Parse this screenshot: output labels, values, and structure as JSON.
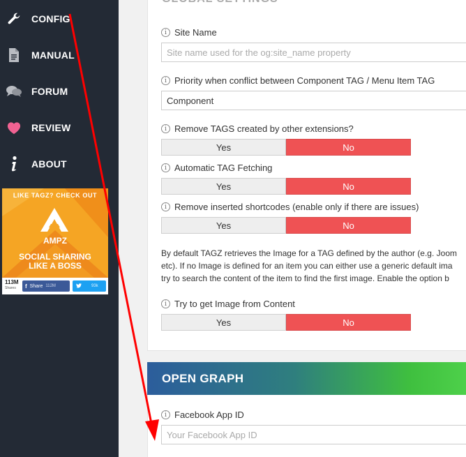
{
  "sidebar": {
    "items": [
      {
        "label": "CONFIG",
        "icon": "wrench-icon"
      },
      {
        "label": "MANUAL",
        "icon": "document-icon"
      },
      {
        "label": "FORUM",
        "icon": "chat-bubbles-icon"
      },
      {
        "label": "REVIEW",
        "icon": "heart-icon"
      },
      {
        "label": "ABOUT",
        "icon": "info-icon"
      }
    ],
    "ad": {
      "headline": "LIKE TAGZ? CHECK OUT",
      "brand": "AMPZ",
      "tagline_1": "SOCIAL SHARING",
      "tagline_2": "LIKE A BOSS",
      "shares_count": "113M",
      "shares_label": "Shares",
      "facebook_label": "Share",
      "facebook_count": "112M",
      "twitter_count": "93k"
    }
  },
  "global_settings": {
    "title": "GLOBAL SETTINGS",
    "site_name": {
      "label": "Site Name",
      "placeholder": "Site name used for the og:site_name property"
    },
    "priority": {
      "label": "Priority when conflict between Component TAG / Menu Item TAG",
      "value": "Component"
    },
    "remove_tags": {
      "label": "Remove TAGS created by other extensions?",
      "yes": "Yes",
      "no": "No",
      "selected": "No"
    },
    "auto_fetch": {
      "label": "Automatic TAG Fetching",
      "yes": "Yes",
      "no": "No",
      "selected": "No"
    },
    "remove_shortcodes": {
      "label": "Remove inserted shortcodes (enable only if there are issues)",
      "yes": "Yes",
      "no": "No",
      "selected": "No"
    },
    "description_lines": [
      "By default TAGZ retrieves the Image for a TAG defined by the author (e.g. Joom",
      "etc). If no Image is defined for an item you can either use a generic default ima",
      "try to search the content of the item to find the first image. Enable the option b"
    ],
    "image_from_content": {
      "label": "Try to get Image from Content",
      "yes": "Yes",
      "no": "No",
      "selected": "No"
    }
  },
  "open_graph": {
    "title": "OPEN GRAPH",
    "app_id": {
      "label": "Facebook App ID",
      "placeholder": "Your Facebook App ID"
    }
  },
  "colors": {
    "sidebar_bg": "#232a35",
    "no_active": "#ef5254",
    "arrow": "#ff0000"
  }
}
